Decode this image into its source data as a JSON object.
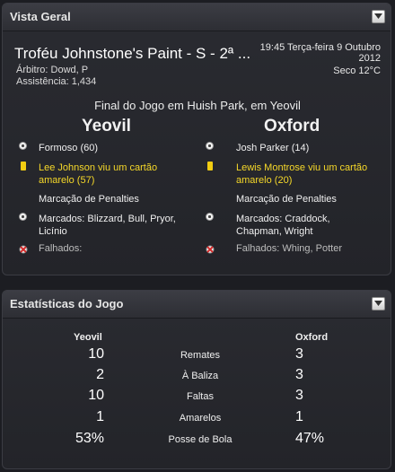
{
  "overview": {
    "header_title": "Vista Geral",
    "competition_title": "Troféu Johnstone's Paint - S - 2ª ...",
    "referee": "Árbitro: Dowd, P",
    "attendance": "Assistência: 1,434",
    "datetime": "19:45 Terça-feira 9 Outubro 2012",
    "weather": "Seco 12°C",
    "final_line": "Final do Jogo em Huish Park, em Yeovil",
    "home_team": "Yeovil",
    "away_team": "Oxford",
    "home_events": {
      "goal": "Formoso (60)",
      "card": "Lee Johnson viu um cartão amarelo (57)",
      "penalties_title": "Marcação de Penalties",
      "scored": "Marcados: Blizzard, Bull, Pryor, Licínio",
      "missed": "Falhados:"
    },
    "away_events": {
      "goal": "Josh Parker (14)",
      "card": "Lewis Montrose viu um cartão amarelo (20)",
      "penalties_title": "Marcação de Penalties",
      "scored": "Marcados: Craddock, Chapman, Wright",
      "missed": "Falhados: Whing, Potter"
    }
  },
  "stats": {
    "header_title": "Estatísticas do Jogo",
    "home_team": "Yeovil",
    "away_team": "Oxford",
    "rows": [
      {
        "label": "Remates",
        "home": "10",
        "away": "3"
      },
      {
        "label": "À Baliza",
        "home": "2",
        "away": "3"
      },
      {
        "label": "Faltas",
        "home": "10",
        "away": "3"
      },
      {
        "label": "Amarelos",
        "home": "1",
        "away": "1"
      },
      {
        "label": "Posse de Bola",
        "home": "53%",
        "away": "47%"
      }
    ]
  },
  "icons": {
    "goal": "football-icon",
    "card": "yellow-card-icon",
    "penalty_scored": "football-icon",
    "penalty_missed": "missed-penalty-icon",
    "collapse": "chevron-down-icon"
  },
  "colors": {
    "card_text": "#f6d829",
    "missed_text": "#bdbdbd"
  }
}
